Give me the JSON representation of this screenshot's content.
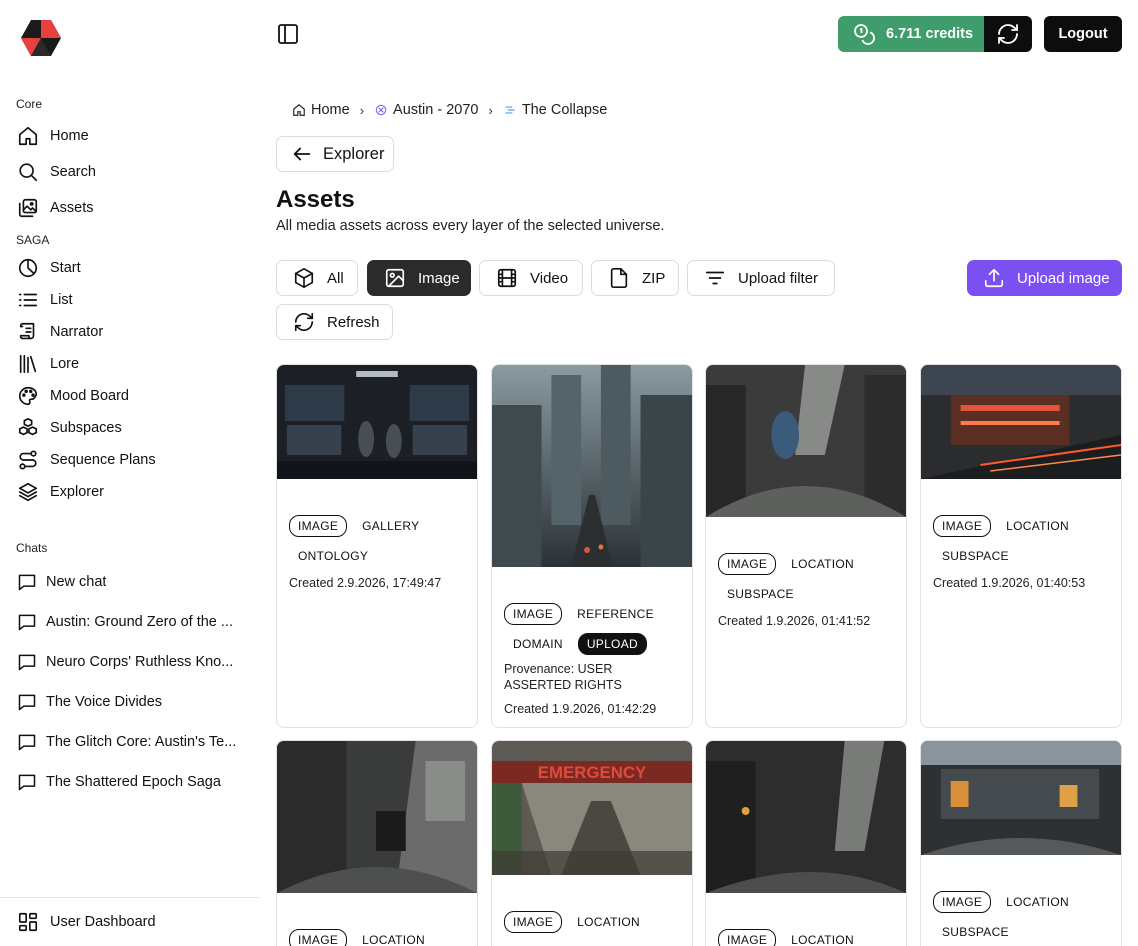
{
  "topbar": {
    "credits_label": "6.711 credits",
    "logout_label": "Logout"
  },
  "sidebar": {
    "core_label": "Core",
    "core_items": [
      {
        "label": "Home",
        "icon": "home-icon"
      },
      {
        "label": "Search",
        "icon": "search-icon"
      },
      {
        "label": "Assets",
        "icon": "image-stack-icon"
      }
    ],
    "saga_label": "SAGA",
    "saga_items": [
      {
        "label": "Start",
        "icon": "pie-chart-icon"
      },
      {
        "label": "List",
        "icon": "list-icon"
      },
      {
        "label": "Narrator",
        "icon": "scroll-icon"
      },
      {
        "label": "Lore",
        "icon": "library-icon"
      },
      {
        "label": "Mood Board",
        "icon": "palette-icon"
      },
      {
        "label": "Subspaces",
        "icon": "boxes-icon"
      },
      {
        "label": "Sequence Plans",
        "icon": "route-icon"
      },
      {
        "label": "Explorer",
        "icon": "layers-icon"
      }
    ],
    "chats_label": "Chats",
    "chats": [
      {
        "label": "New chat"
      },
      {
        "label": "Austin: Ground Zero of the ..."
      },
      {
        "label": "Neuro Corps' Ruthless Kno..."
      },
      {
        "label": "The Voice Divides"
      },
      {
        "label": "The Glitch Core: Austin's Te..."
      },
      {
        "label": "The Shattered Epoch Saga"
      }
    ],
    "footer_label": "User Dashboard"
  },
  "breadcrumb": {
    "home": "Home",
    "universe": "Austin - 2070",
    "layer": "The Collapse"
  },
  "back_label": "Explorer",
  "page": {
    "title": "Assets",
    "subtitle": "All media assets across every layer of the selected universe."
  },
  "filters": {
    "all": "All",
    "image": "Image",
    "video": "Video",
    "zip": "ZIP",
    "upload_filter": "Upload filter",
    "refresh": "Refresh",
    "active": "Image"
  },
  "upload_label": "Upload image",
  "colors": {
    "credits_green": "#3f9d6b",
    "upload_purple": "#7b4ff0",
    "active_filter": "#2b2b2b",
    "logo_red": "#e8403f"
  },
  "cards": [
    {
      "tags": [
        "IMAGE",
        "GALLERY",
        "ONTOLOGY"
      ],
      "created": "Created 2.9.2026, 17:49:47"
    },
    {
      "tags": [
        "IMAGE",
        "REFERENCE",
        "DOMAIN",
        "UPLOAD"
      ],
      "provenance": "Provenance: USER ASSERTED RIGHTS",
      "created": "Created 1.9.2026, 01:42:29"
    },
    {
      "tags": [
        "IMAGE",
        "LOCATION",
        "SUBSPACE"
      ],
      "created": "Created 1.9.2026, 01:41:52"
    },
    {
      "tags": [
        "IMAGE",
        "LOCATION",
        "SUBSPACE"
      ],
      "created": "Created 1.9.2026, 01:40:53"
    },
    {
      "tags": [
        "IMAGE",
        "LOCATION"
      ]
    },
    {
      "tags": [
        "IMAGE",
        "LOCATION"
      ],
      "image_sign_text": "EMERGENCY"
    },
    {
      "tags": [
        "IMAGE",
        "LOCATION"
      ]
    },
    {
      "tags": [
        "IMAGE",
        "LOCATION",
        "SUBSPACE"
      ]
    }
  ]
}
